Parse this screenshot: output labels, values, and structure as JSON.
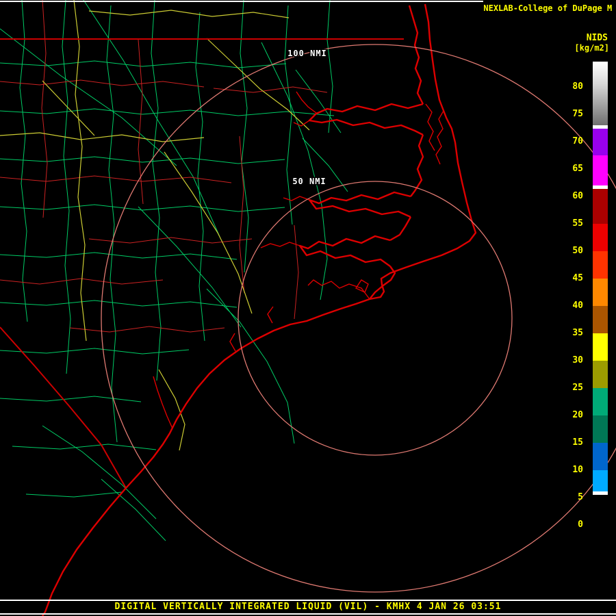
{
  "header": {
    "source_line": "NEXLAB-College of DuPage",
    "clipped_char": "M",
    "units_label": "NIDS",
    "units_sub": "[kg/m2]"
  },
  "footer": {
    "product_title": "DIGITAL VERTICALLY INTEGRATED LIQUID (VIL) - KMHX 4 JAN 26 03:51"
  },
  "range_rings": {
    "inner_label": "50 NMI",
    "outer_label": "100 NMI"
  },
  "colorbar": {
    "ticks": [
      80,
      75,
      70,
      65,
      60,
      55,
      50,
      45,
      40,
      35,
      30,
      25,
      20,
      15,
      10,
      5,
      0
    ],
    "segments": [
      {
        "from": -2.9,
        "to": 5.5,
        "color": "#000000"
      },
      {
        "from": 5.5,
        "to": 6.1,
        "color": "#ffffff"
      },
      {
        "from": 6.1,
        "to": 10,
        "color": "#00aaff"
      },
      {
        "from": 10,
        "to": 15,
        "color": "#0066cc"
      },
      {
        "from": 15,
        "to": 20,
        "color": "#007755"
      },
      {
        "from": 20,
        "to": 25,
        "color": "#00aa77"
      },
      {
        "from": 25,
        "to": 30,
        "color": "#9c9c00"
      },
      {
        "from": 30,
        "to": 35,
        "color": "#ffff00"
      },
      {
        "from": 35,
        "to": 40,
        "color": "#aa5500"
      },
      {
        "from": 40,
        "to": 45,
        "color": "#ff8800"
      },
      {
        "from": 45,
        "to": 50,
        "color": "#ff3300"
      },
      {
        "from": 50,
        "to": 55,
        "color": "#ee0000"
      },
      {
        "from": 55,
        "to": 61.4,
        "color": "#aa0000"
      },
      {
        "from": 61.4,
        "to": 62,
        "color": "#ffffff"
      },
      {
        "from": 62,
        "to": 67.5,
        "color": "#ff00ff"
      },
      {
        "from": 67.5,
        "to": 72.4,
        "color": "#9900ee"
      },
      {
        "from": 72.4,
        "to": 73,
        "color": "#ffffff"
      },
      {
        "from": 73,
        "to": 84.6,
        "color": "linear-gradient(to bottom, #ffffff 0%, #d8d8d8 35%, #6f6f6f 100%)"
      }
    ]
  },
  "colors": {
    "background": "#000000",
    "text_accent": "#ffff00",
    "coastline": "#dd0000",
    "county_lines": "#00cc66",
    "highways": "#cccc33",
    "secondary_roads": "#cc2222",
    "state_border": "#cc0000",
    "range_ring": "#e07a72",
    "frame_line": "#ffffff"
  }
}
